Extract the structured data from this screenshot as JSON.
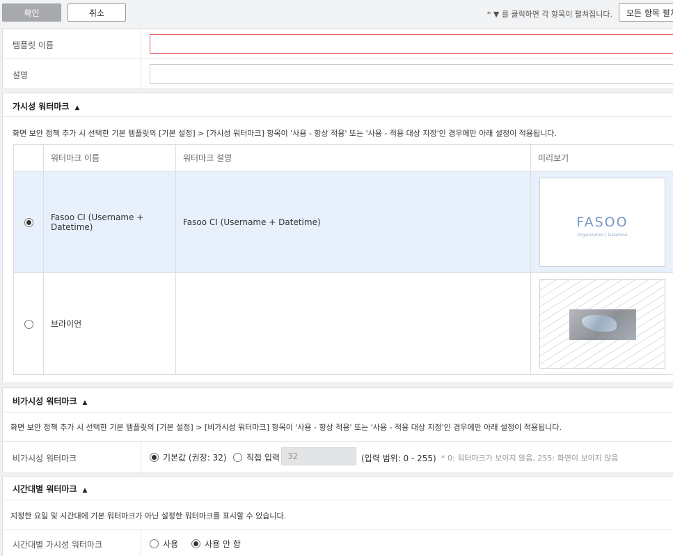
{
  "toolbar": {
    "ok_label": "확인",
    "cancel_label": "취소",
    "hint": "* ▼ 를 클릭하면 각 항목이 펼쳐집니다.",
    "expand_all_label": "모든 항목 펼치기"
  },
  "basic": {
    "template_name_label": "템플릿 이름",
    "template_name_value": "",
    "description_label": "설명",
    "description_value": ""
  },
  "visible": {
    "title": "가시성 워터마크",
    "caret": "▲",
    "desc": "화면 보안 정책 추가 시 선택한 기본 템플릿의 [기본 설정] > [가시성 워터마크] 항목이 '사용 - 항상 적용' 또는 '사용 - 적용 대상 지정'인 경우에만 아래 설정이 적용됩니다.",
    "columns": [
      "워터마크 이름",
      "워터마크 설명",
      "미리보기"
    ],
    "rows": [
      {
        "name": "Fasoo CI (Username + Datetime)",
        "description": "Fasoo CI (Username + Datetime)",
        "selected": true,
        "preview_text": "FASOO",
        "preview_sub": "Organization | Datetime"
      },
      {
        "name": "브라이언",
        "description": "",
        "selected": false
      }
    ]
  },
  "invisible": {
    "title": "비가시성 워터마크",
    "caret": "▲",
    "desc": "화면 보안 정책 추가 시 선택한 기본 템플릿의 [기본 설정] > [비가시성 워터마크] 항목이 '사용 - 항상 적용' 또는 '사용 - 적용 대상 지정'인 경우에만 아래 설정이 적용됩니다.",
    "label": "비가시성 워터마크",
    "option_default": "기본값 (권장: 32)",
    "option_custom": "직접 입력",
    "input_value": "32",
    "range": "(입력 범위: 0 - 255)",
    "note": "* 0: 워터마크가 보이지 않음, 255: 화면이 보이지 않음"
  },
  "timebased": {
    "title": "시간대별 워터마크",
    "caret": "▲",
    "desc": "지정한 요일 및 시간대에 기본 워터마크가 아닌 설정한 워터마크를 표시할 수 있습니다.",
    "label": "시간대별 가시성 워터마크",
    "option_use": "사용",
    "option_nouse": "사용 안 함"
  }
}
